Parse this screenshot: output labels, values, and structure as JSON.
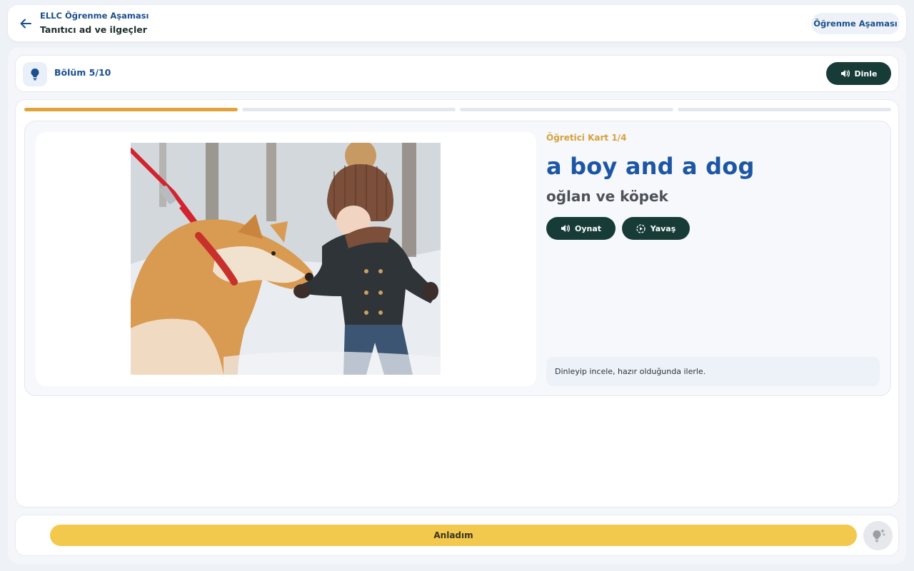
{
  "header": {
    "subtitle": "ELLC Öğrenme Aşaması",
    "title": "Tanıtıcı ad ve ilgeçler",
    "stage_label": "Öğrenme Aşaması",
    "back_icon": "arrow-left-icon"
  },
  "section": {
    "label": "Bölüm 5/10",
    "icon": "lightbulb-icon",
    "listen_label": "Dinle"
  },
  "progress": {
    "segments": 4,
    "active": 1,
    "active_color": "#e0a33a"
  },
  "card": {
    "tag": "Öğretici Kart 1/4",
    "word": "a boy and a dog",
    "translation": "oğlan ve köpek",
    "play_label": "Oynat",
    "slow_label": "Yavaş",
    "hint": "Dinleyip incele, hazır olduğunda ilerle."
  },
  "footer": {
    "confirm_label": "Anladım",
    "hint_icon": "lightbulb-sparkle-icon"
  },
  "colors": {
    "brand_blue": "#1d56a4",
    "dark_green": "#173c37",
    "accent_yellow": "#f2c94c",
    "tag_orange": "#d9a03a"
  }
}
